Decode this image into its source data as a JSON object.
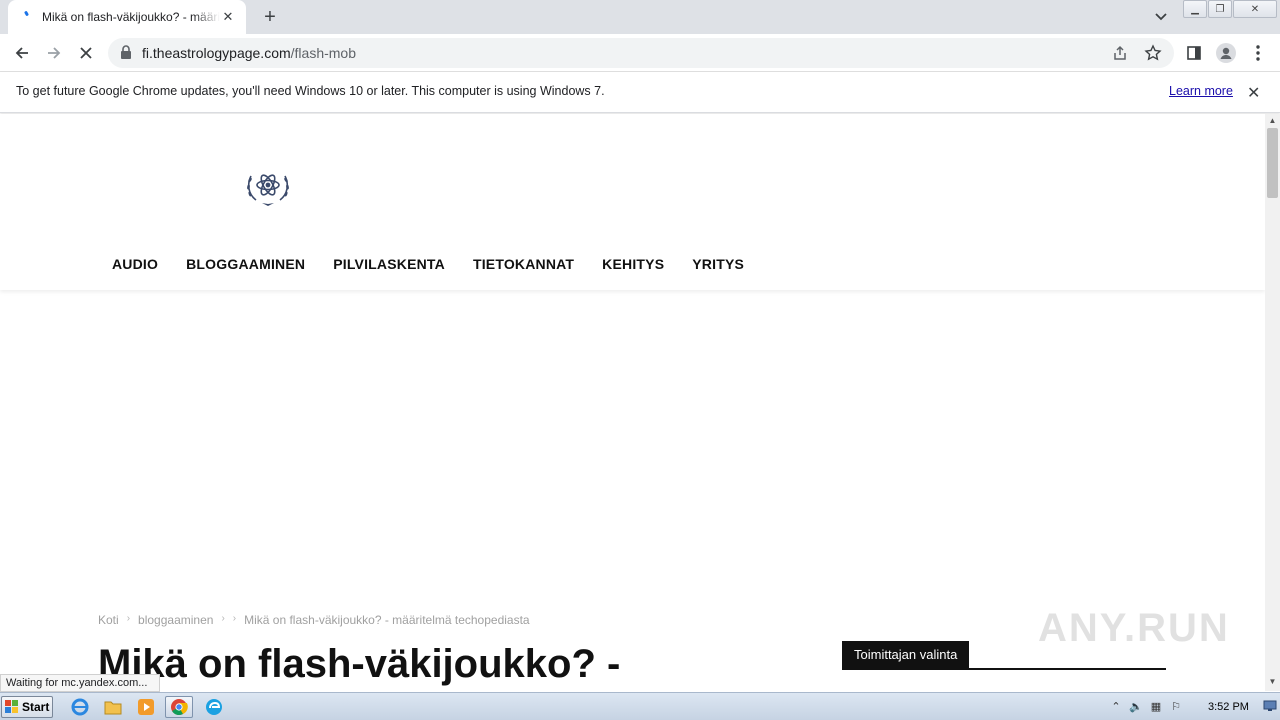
{
  "browser": {
    "tab": {
      "title": "Mikä on flash-väkijoukko? - määritelmä techopediasta",
      "loading": true
    },
    "url": {
      "host": "fi.theastrologypage.com",
      "path": "/flash-mob"
    },
    "icons": {
      "back": "arrow-left-icon",
      "forward": "arrow-right-icon",
      "stop": "close-icon",
      "lock": "lock-icon",
      "share": "share-icon",
      "bookmark": "star-icon",
      "sidepanel": "side-panel-icon",
      "profile": "profile-icon",
      "menu": "more-vert-icon",
      "tab_search": "chevron-down-icon"
    },
    "infobar": {
      "message": "To get future Google Chrome updates, you'll need Windows 10 or later. This computer is using Windows 7.",
      "link": "Learn more"
    },
    "status": "Waiting for mc.yandex.com..."
  },
  "page": {
    "logo_icon": "laurel-atom-logo-icon",
    "nav": [
      "AUDIO",
      "BLOGGAAMINEN",
      "PILVILASKENTA",
      "TIETOKANNAT",
      "KEHITYS",
      "YRITYS"
    ],
    "breadcrumb": {
      "home": "Koti",
      "category": "bloggaaminen",
      "sep": "›",
      "current": "Mikä on flash-väkijoukko? - määritelmä techopediasta"
    },
    "title": "Mikä on flash-väkijoukko? -",
    "editor_pick": "Toimittajan valinta",
    "watermark": "ANY.RUN"
  },
  "taskbar": {
    "start": "Start",
    "apps": [
      "ie-icon",
      "explorer-icon",
      "media-player-icon",
      "chrome-icon",
      "edge-icon"
    ],
    "clock": "3:52 PM"
  },
  "colors": {
    "accent": "#1a73e8",
    "link": "#1a0dab",
    "logo": "#3b4a6b",
    "nav_text": "#111111"
  }
}
